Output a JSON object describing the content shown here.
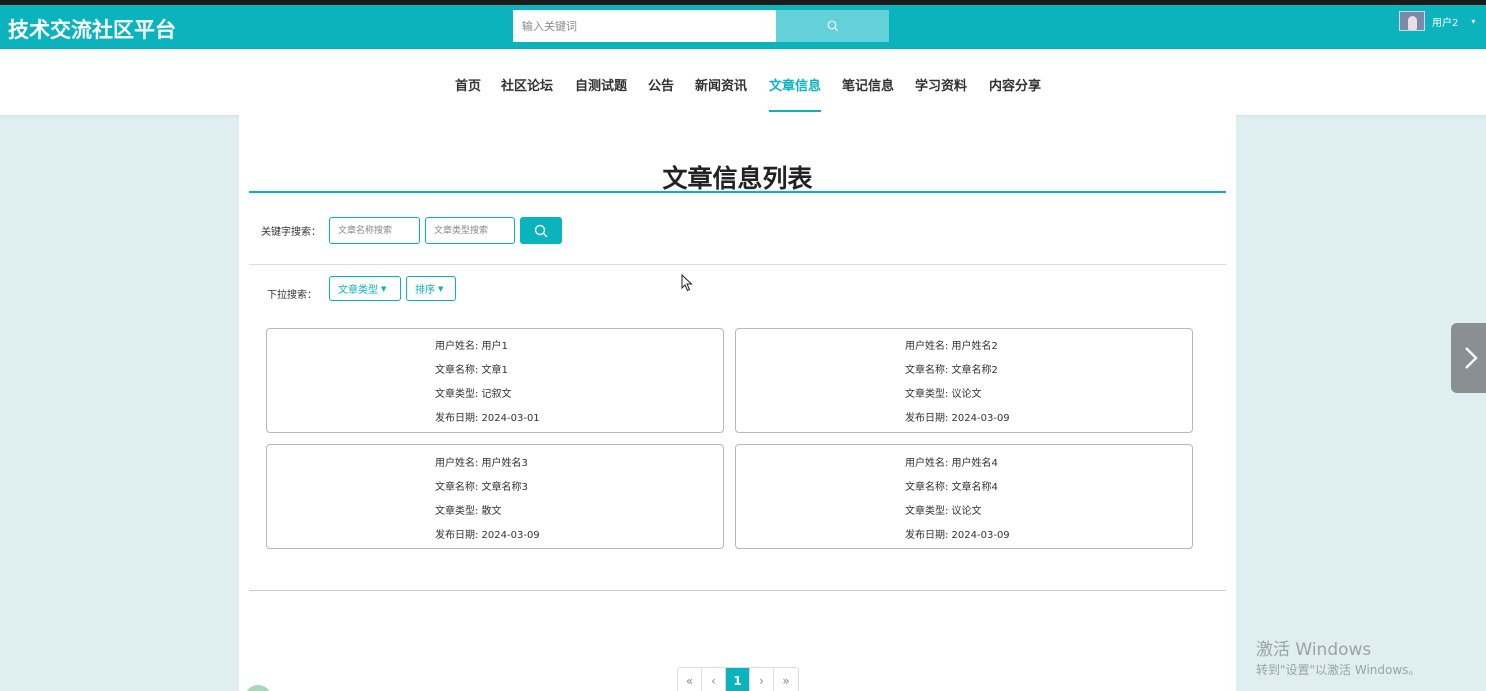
{
  "header": {
    "brand": "技术交流社区平台",
    "search_placeholder": "输入关键词",
    "user_name": "用户2",
    "accent_color": "#0bb4bd"
  },
  "nav": {
    "items": [
      "首页",
      "社区论坛",
      "自测试题",
      "公告",
      "新闻资讯",
      "文章信息",
      "笔记信息",
      "学习资料",
      "内容分享"
    ],
    "active": "文章信息"
  },
  "page": {
    "title": "文章信息列表",
    "keyword_label": "关键字搜索：",
    "name_placeholder": "文章名称搜索",
    "type_placeholder": "文章类型搜索",
    "dropdown_label": "下拉搜索：",
    "dropdown_type": "文章类型",
    "dropdown_sort": "排序"
  },
  "cards": [
    {
      "user_label": "用户姓名: 用户1",
      "name_label": "文章名称: 文章1",
      "type_label": "文章类型: 记叙文",
      "date_label": "发布日期: 2024-03-01"
    },
    {
      "user_label": "用户姓名: 用户姓名2",
      "name_label": "文章名称: 文章名称2",
      "type_label": "文章类型: 议论文",
      "date_label": "发布日期: 2024-03-09"
    },
    {
      "user_label": "用户姓名: 用户姓名3",
      "name_label": "文章名称: 文章名称3",
      "type_label": "文章类型: 散文",
      "date_label": "发布日期: 2024-03-09"
    },
    {
      "user_label": "用户姓名: 用户姓名4",
      "name_label": "文章名称: 文章名称4",
      "type_label": "文章类型: 议论文",
      "date_label": "发布日期: 2024-03-09"
    }
  ],
  "pagination": {
    "first": "«",
    "prev": "‹",
    "current": "1",
    "next": "›",
    "last": "»"
  },
  "watermark": {
    "line1": "激活 Windows",
    "line2": "转到\"设置\"以激活 Windows。"
  }
}
